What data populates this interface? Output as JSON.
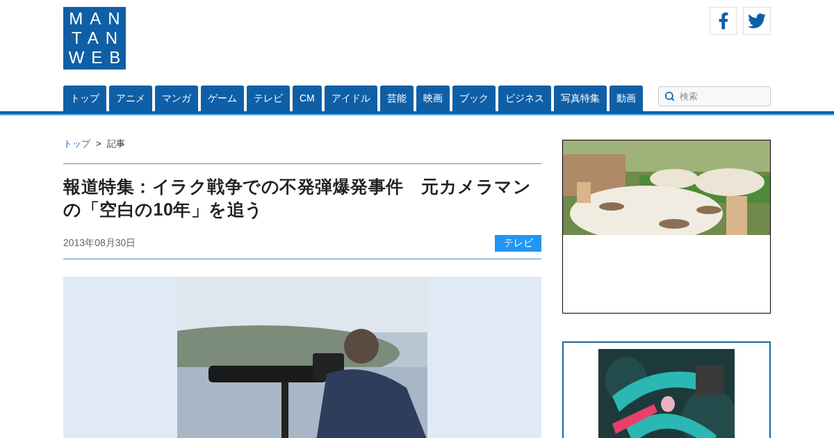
{
  "logo": {
    "lines": [
      "MAN",
      "TAN",
      "WEB"
    ]
  },
  "nav": {
    "tabs": [
      {
        "label": "トップ",
        "selected": false
      },
      {
        "label": "アニメ",
        "selected": false
      },
      {
        "label": "マンガ",
        "selected": false
      },
      {
        "label": "ゲーム",
        "selected": false
      },
      {
        "label": "テレビ",
        "selected": false
      },
      {
        "label": "CM",
        "selected": false
      },
      {
        "label": "アイドル",
        "selected": false
      },
      {
        "label": "芸能",
        "selected": false
      },
      {
        "label": "映画",
        "selected": false
      },
      {
        "label": "ブック",
        "selected": false
      },
      {
        "label": "ビジネス",
        "selected": false
      },
      {
        "label": "写真特集",
        "selected": false
      },
      {
        "label": "動画",
        "selected": false
      }
    ],
    "search": {
      "placeholder": "検索"
    }
  },
  "breadcrumb": [
    {
      "label": "トップ",
      "kind": "link"
    },
    {
      "label": ">",
      "kind": "separator"
    },
    {
      "label": "記事",
      "kind": "current"
    }
  ],
  "article": {
    "title": "報道特集：イラク戦争での不発弾爆発事件　元カメラマンの「空白の10年」を追う",
    "date": "2013年08月30日",
    "category": "テレビ"
  }
}
